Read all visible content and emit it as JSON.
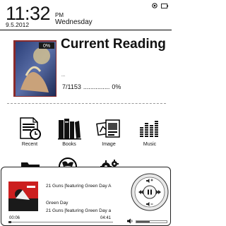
{
  "status": {
    "time": "11:32",
    "ampm": "PM",
    "date": "9.5.2012",
    "weekday": "Wednesday",
    "icons": [
      "target-icon",
      "battery-icon"
    ]
  },
  "current_reading": {
    "heading": "Current Reading",
    "dots": "...",
    "cover_badge": "0%",
    "page": "7/1153",
    "leader": "...............",
    "percent": "0%"
  },
  "apps": [
    {
      "label": "Recent",
      "icon": "recent-document-icon"
    },
    {
      "label": "Books",
      "icon": "books-icon"
    },
    {
      "label": "Image",
      "icon": "image-icon"
    },
    {
      "label": "Music",
      "icon": "music-equalizer-icon"
    }
  ],
  "apps_row2": [
    "folder-icon",
    "globe-icon",
    "gears-icon"
  ],
  "player": {
    "track_title": "21 Guns [featuring Green Day A",
    "artist": "Green Day",
    "track_title_2": "21 Guns [featuring Green Day a",
    "elapsed": "00:06",
    "duration": "04:41",
    "progress": 0.03,
    "volume": 0.45
  }
}
